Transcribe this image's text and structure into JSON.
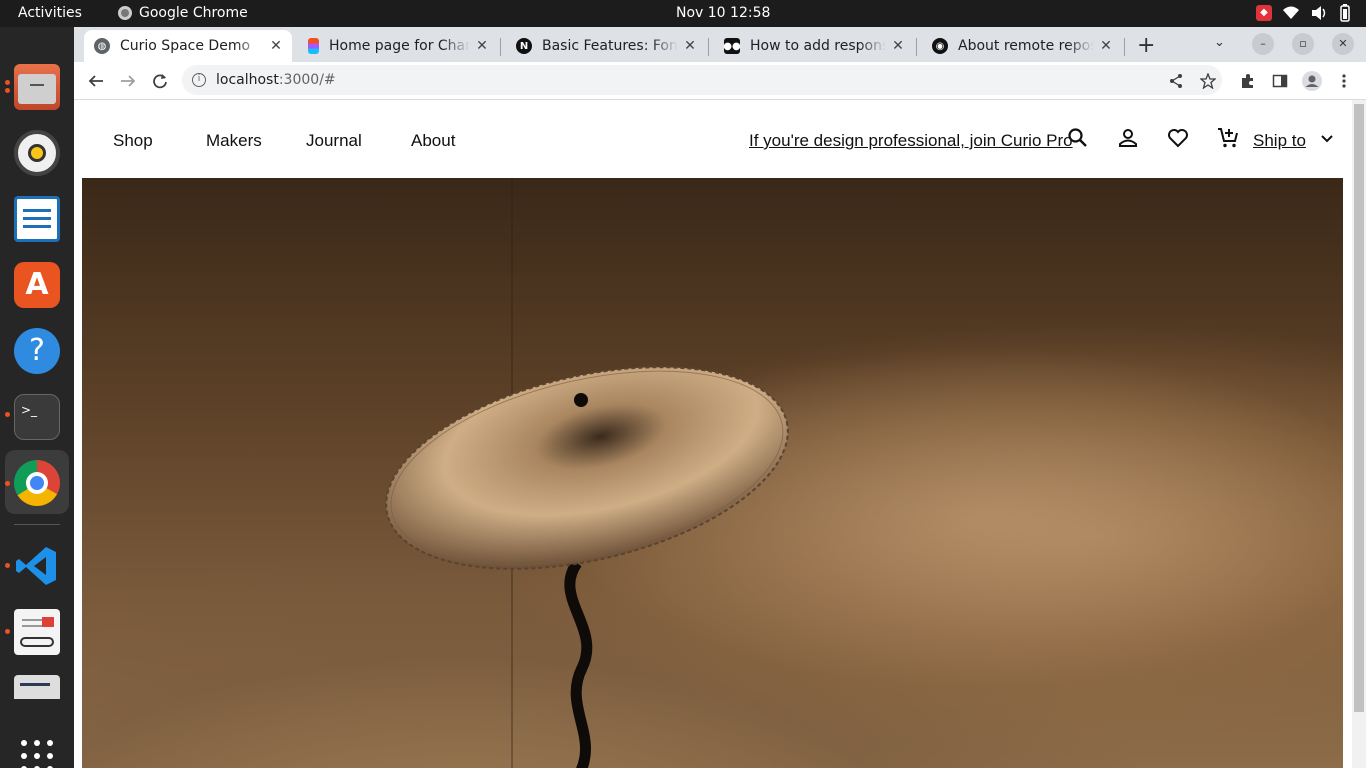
{
  "system": {
    "activities": "Activities",
    "app_name": "Google Chrome",
    "clock": "Nov 10  12:58"
  },
  "dock": {
    "icons": [
      "files-icon",
      "rhythmbox-icon",
      "writer-icon",
      "app-center-icon",
      "help-icon",
      "terminal-icon",
      "chrome-icon",
      "vscode-icon",
      "document-viewer-icon",
      "text-editor-icon",
      "show-apps-icon"
    ]
  },
  "browser": {
    "tabs": [
      {
        "title": "Curio Space Demo",
        "favicon": "globe-icon",
        "active": true
      },
      {
        "title": "Home page for Change",
        "favicon": "figma-icon",
        "active": false
      },
      {
        "title": "Basic Features: Font O",
        "favicon": "nextjs-icon",
        "active": false
      },
      {
        "title": "How to add responsive",
        "favicon": "medium-icon",
        "active": false
      },
      {
        "title": "About remote reposit",
        "favicon": "github-icon",
        "active": false
      }
    ],
    "url_host": "localhost",
    "url_path": ":3000/#"
  },
  "site": {
    "nav": {
      "shop": "Shop",
      "makers": "Makers",
      "journal": "Journal",
      "about": "About",
      "pro_link": "If you're design professional, join Curio Pro",
      "ship_to": "Ship to"
    },
    "hero_image": "pleated-paper-lamp-photo"
  }
}
